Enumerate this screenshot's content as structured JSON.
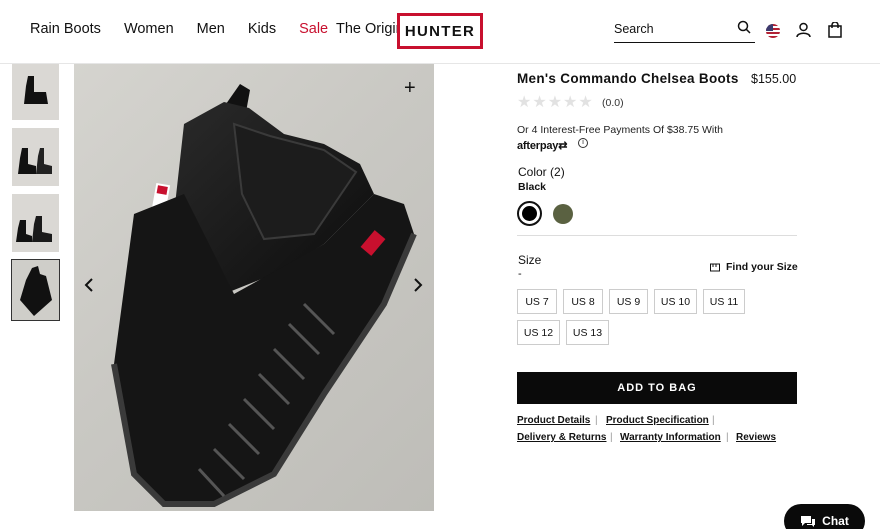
{
  "nav": {
    "items": [
      "Rain Boots",
      "Women",
      "Men",
      "Kids",
      "Sale"
    ],
    "clipped_item": "The Original",
    "logo": "HUNTER"
  },
  "search": {
    "label": "Search"
  },
  "product": {
    "title": "Men's Commando Chelsea Boots",
    "price": "$155.00",
    "rating": "(0.0)",
    "afterpay_text": "Or 4 Interest-Free Payments Of $38.75 With",
    "afterpay_brand": "afterpay",
    "color_label": "Color",
    "color_count": "(2)",
    "color_value": "Black",
    "swatches": [
      "#000000",
      "#5a6141"
    ],
    "size_label": "Size",
    "size_value": "-",
    "find_size": "Find your Size",
    "sizes": [
      "US 7",
      "US 8",
      "US 9",
      "US 10",
      "US 11",
      "US 12",
      "US 13"
    ],
    "add_to_bag": "ADD TO BAG",
    "links": [
      "Product Details",
      "Product Specification",
      "Delivery & Returns",
      "Warranty Information",
      "Reviews"
    ]
  },
  "chat": {
    "label": "Chat"
  },
  "colors": {
    "brand_red": "#c8102e",
    "sale_red": "#c8102e",
    "button_black": "#0a0a0a"
  }
}
